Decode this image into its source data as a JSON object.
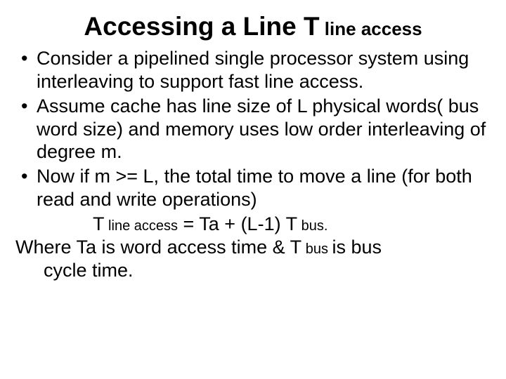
{
  "title": {
    "main": "Accessing a Line T",
    "sub": " line access"
  },
  "bullets": {
    "b1": "Consider a pipelined single processor system using interleaving to support fast line access.",
    "b2": "Assume cache has line size of L physical words( bus word size) and memory uses low order interleaving of degree m.",
    "b3": "Now if m >= L, the total time to move a line (for both read and write operations)"
  },
  "formula": {
    "lhs_T": "T",
    "lhs_sub": " line access",
    "eq": " = Ta + (L-1) T",
    "rhs_sub": " bus."
  },
  "closing": {
    "line1_a": "Where Ta is word access time & T",
    "line1_sub": " bus ",
    "line1_b": "is bus",
    "line2": "cycle time."
  }
}
